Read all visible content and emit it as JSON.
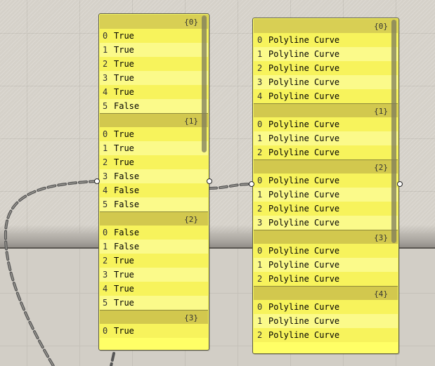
{
  "left_panel": {
    "branches": [
      {
        "path": "{0}",
        "items": [
          {
            "index": "0",
            "value": "True"
          },
          {
            "index": "1",
            "value": "True"
          },
          {
            "index": "2",
            "value": "True"
          },
          {
            "index": "3",
            "value": "True"
          },
          {
            "index": "4",
            "value": "True"
          },
          {
            "index": "5",
            "value": "False"
          }
        ]
      },
      {
        "path": "{1}",
        "items": [
          {
            "index": "0",
            "value": "True"
          },
          {
            "index": "1",
            "value": "True"
          },
          {
            "index": "2",
            "value": "True"
          },
          {
            "index": "3",
            "value": "False"
          },
          {
            "index": "4",
            "value": "False"
          },
          {
            "index": "5",
            "value": "False"
          }
        ]
      },
      {
        "path": "{2}",
        "items": [
          {
            "index": "0",
            "value": "False"
          },
          {
            "index": "1",
            "value": "False"
          },
          {
            "index": "2",
            "value": "True"
          },
          {
            "index": "3",
            "value": "True"
          },
          {
            "index": "4",
            "value": "True"
          },
          {
            "index": "5",
            "value": "True"
          }
        ]
      },
      {
        "path": "{3}",
        "items": [
          {
            "index": "0",
            "value": "True"
          }
        ]
      }
    ]
  },
  "right_panel": {
    "branches": [
      {
        "path": "{0}",
        "items": [
          {
            "index": "0",
            "value": "Polyline Curve"
          },
          {
            "index": "1",
            "value": "Polyline Curve"
          },
          {
            "index": "2",
            "value": "Polyline Curve"
          },
          {
            "index": "3",
            "value": "Polyline Curve"
          },
          {
            "index": "4",
            "value": "Polyline Curve"
          }
        ]
      },
      {
        "path": "{1}",
        "items": [
          {
            "index": "0",
            "value": "Polyline Curve"
          },
          {
            "index": "1",
            "value": "Polyline Curve"
          },
          {
            "index": "2",
            "value": "Polyline Curve"
          }
        ]
      },
      {
        "path": "{2}",
        "items": [
          {
            "index": "0",
            "value": "Polyline Curve"
          },
          {
            "index": "1",
            "value": "Polyline Curve"
          },
          {
            "index": "2",
            "value": "Polyline Curve"
          },
          {
            "index": "3",
            "value": "Polyline Curve"
          }
        ]
      },
      {
        "path": "{3}",
        "items": [
          {
            "index": "0",
            "value": "Polyline Curve"
          },
          {
            "index": "1",
            "value": "Polyline Curve"
          },
          {
            "index": "2",
            "value": "Polyline Curve"
          }
        ]
      },
      {
        "path": "{4}",
        "items": [
          {
            "index": "0",
            "value": "Polyline Curve"
          },
          {
            "index": "1",
            "value": "Polyline Curve"
          },
          {
            "index": "2",
            "value": "Polyline Curve"
          }
        ]
      }
    ]
  },
  "colors": {
    "panel_fill": "#ffff66",
    "branch_header": "#d2c84e",
    "canvas": "#d4d0c8",
    "wire": "#555555"
  }
}
